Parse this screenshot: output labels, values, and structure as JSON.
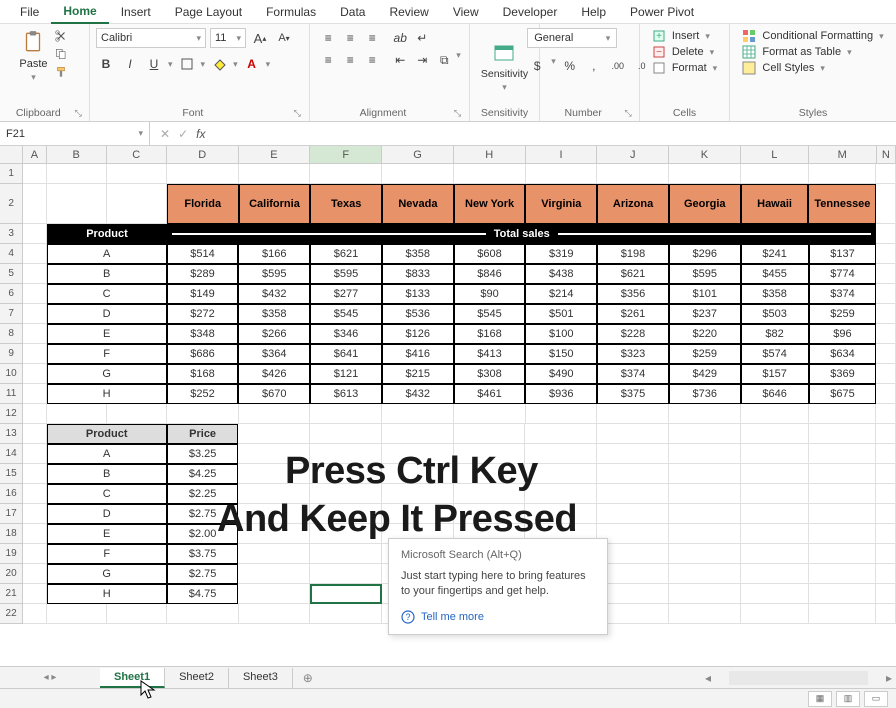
{
  "menu": {
    "items": [
      "File",
      "Home",
      "Insert",
      "Page Layout",
      "Formulas",
      "Data",
      "Review",
      "View",
      "Developer",
      "Help",
      "Power Pivot"
    ],
    "active": "Home"
  },
  "ribbon": {
    "clipboard": {
      "paste": "Paste",
      "label": "Clipboard"
    },
    "font": {
      "name": "Calibri",
      "size": "11",
      "label": "Font"
    },
    "alignment": {
      "label": "Alignment"
    },
    "sensitivity": {
      "label": "Sensitivity",
      "btn": "Sensitivity"
    },
    "number": {
      "format": "General",
      "label": "Number"
    },
    "cells": {
      "insert": "Insert",
      "delete": "Delete",
      "format": "Format",
      "label": "Cells"
    },
    "styles": {
      "cond": "Conditional Formatting",
      "table": "Format as Table",
      "cellstyles": "Cell Styles",
      "label": "Styles"
    }
  },
  "formula_bar": {
    "name_box": "F21",
    "value": ""
  },
  "cols": {
    "A": 24,
    "B": 62,
    "C": 62,
    "D": 74,
    "E": 74,
    "F": 74,
    "G": 74,
    "H": 74,
    "I": 74,
    "J": 74,
    "K": 74,
    "L": 70,
    "M": 70,
    "N": 20
  },
  "state_headers": [
    "Florida",
    "California",
    "Texas",
    "Nevada",
    "New York",
    "Virginia",
    "Arizona",
    "Georgia",
    "Hawaii",
    "Tennessee"
  ],
  "total_sales_label": "Total sales",
  "product_label": "Product",
  "products": [
    "A",
    "B",
    "C",
    "D",
    "E",
    "F",
    "G",
    "H"
  ],
  "sales": [
    [
      "$514",
      "$166",
      "$621",
      "$358",
      "$608",
      "$319",
      "$198",
      "$296",
      "$241",
      "$137"
    ],
    [
      "$289",
      "$595",
      "$595",
      "$833",
      "$846",
      "$438",
      "$621",
      "$595",
      "$455",
      "$774"
    ],
    [
      "$149",
      "$432",
      "$277",
      "$133",
      "$90",
      "$214",
      "$356",
      "$101",
      "$358",
      "$374"
    ],
    [
      "$272",
      "$358",
      "$545",
      "$536",
      "$545",
      "$501",
      "$261",
      "$237",
      "$503",
      "$259"
    ],
    [
      "$348",
      "$266",
      "$346",
      "$126",
      "$168",
      "$100",
      "$228",
      "$220",
      "$82",
      "$96"
    ],
    [
      "$686",
      "$364",
      "$641",
      "$416",
      "$413",
      "$150",
      "$323",
      "$259",
      "$574",
      "$634"
    ],
    [
      "$168",
      "$426",
      "$121",
      "$215",
      "$308",
      "$490",
      "$374",
      "$429",
      "$157",
      "$369"
    ],
    [
      "$252",
      "$670",
      "$613",
      "$432",
      "$461",
      "$936",
      "$375",
      "$736",
      "$646",
      "$675"
    ]
  ],
  "price_table": {
    "headers": [
      "Product",
      "Price"
    ],
    "rows": [
      [
        "A",
        "$3.25"
      ],
      [
        "B",
        "$4.25"
      ],
      [
        "C",
        "$2.25"
      ],
      [
        "D",
        "$2.75"
      ],
      [
        "E",
        "$2.00"
      ],
      [
        "F",
        "$3.75"
      ],
      [
        "G",
        "$2.75"
      ],
      [
        "H",
        "$4.75"
      ]
    ]
  },
  "overlay": {
    "line1": "Press Ctrl Key",
    "line2": "And Keep It Pressed"
  },
  "tooltip": {
    "title": "Microsoft Search (Alt+Q)",
    "body": "Just start typing here to bring features to your fingertips and get help.",
    "link": "Tell me more"
  },
  "tabs": {
    "items": [
      "Sheet1",
      "Sheet2",
      "Sheet3"
    ],
    "active": "Sheet1"
  },
  "icons": {
    "scissors": "cut-icon",
    "copy": "copy-icon",
    "brush": "format-painter-icon"
  }
}
